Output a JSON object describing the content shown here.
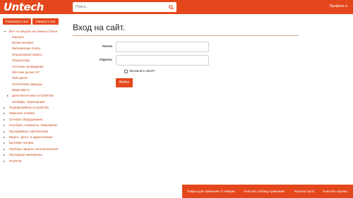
{
  "header": {
    "logo_text": "Untech",
    "search_placeholder": "Поиск...",
    "profile_label": "Профиль",
    "profile_caret": "▾"
  },
  "sidebar": {
    "expand_all": "Развернуть все",
    "collapse_all": "Свернуть все",
    "items": [
      {
        "label": "Все что внутри системного блока",
        "bullet": "▾"
      },
      {
        "label": "Корпуса"
      },
      {
        "label": "Блоки питания"
      },
      {
        "label": "Материнские платы"
      },
      {
        "label": "Оперативная память"
      },
      {
        "label": "Процессоры"
      },
      {
        "label": "Системы охлаждения"
      },
      {
        "label": "Жесткие диски 3.5\""
      },
      {
        "label": "SSD диски"
      },
      {
        "label": "Оптические приводы"
      },
      {
        "label": "Видеокарты"
      },
      {
        "label": "Дополнительные устройства",
        "bullet": "▸"
      },
      {
        "label": "Шлейфы, переходники"
      },
      {
        "label": "Периферийные устройства",
        "bullet": "▸"
      },
      {
        "label": "Офисная техника",
        "bullet": "▸"
      },
      {
        "label": "Сетевое оборудование",
        "bullet": "▸"
      },
      {
        "label": "Ноутбуки, планшеты, смартфоны",
        "bullet": "▸"
      },
      {
        "label": "Программное обеспечение",
        "bullet": "▸"
      },
      {
        "label": "Видео-, фото- и аудиотехника",
        "bullet": "▸"
      },
      {
        "label": "Бытовая техника",
        "bullet": "▸"
      },
      {
        "label": "Приборы защиты электропитания",
        "bullet": "▸"
      },
      {
        "label": "Расходные материалы",
        "bullet": "▸"
      },
      {
        "label": "РАЗНОЕ",
        "bullet": "▸"
      }
    ]
  },
  "login": {
    "title": "Вход на сайт.",
    "login_label": "Логин",
    "password_label": "Пароль",
    "remember_label": "Запомнить меня?",
    "submit_label": "Войти"
  },
  "bottombar": {
    "items": [
      "Товары для сравнения: 0 товаров",
      "Очистить таблицу сравнения",
      "Корзина пуста",
      "Очистить корзину"
    ]
  },
  "colors": {
    "accent": "#e4471b",
    "link": "#c84a1e"
  }
}
